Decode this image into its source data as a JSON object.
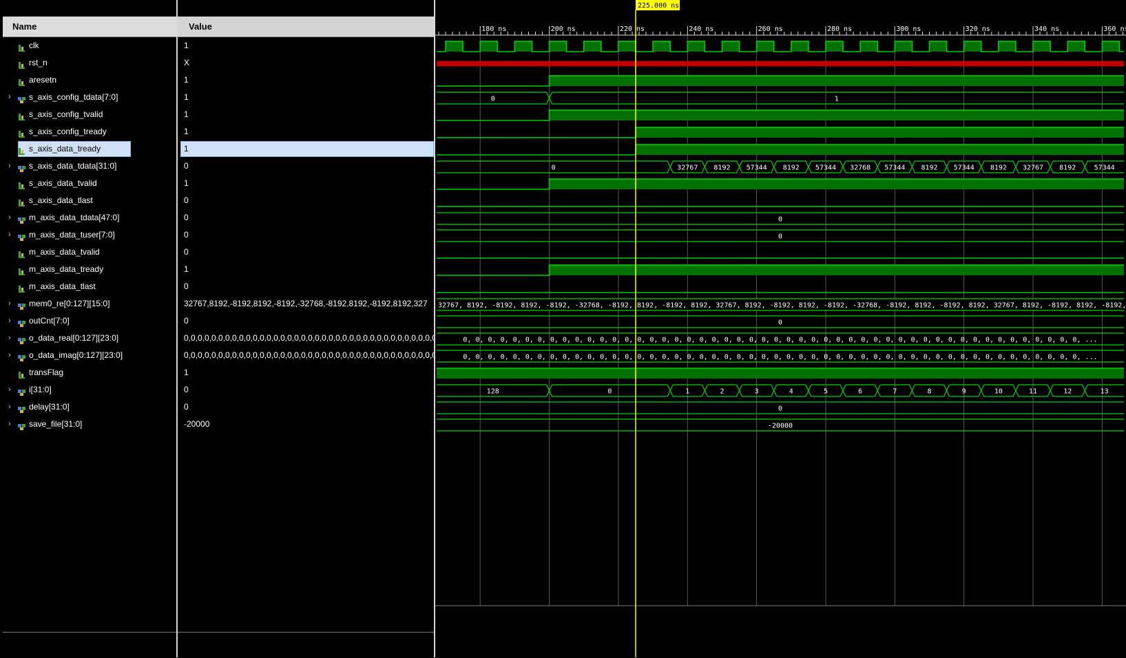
{
  "headers": {
    "name": "Name",
    "value": "Value"
  },
  "cursor_label": "225.000 ns",
  "colors": {
    "wave_green": "#00d400",
    "wave_fill": "#007000",
    "undefined_red": "#c00000",
    "cursor_yellow": "#ffff00",
    "selection": "#cfe0f7",
    "header_bg": "#dcdcdc",
    "grid": "#5a5a5a"
  },
  "time_axis": {
    "unit": "ns",
    "ticks": [
      {
        "t": 180,
        "label": "180 ns"
      },
      {
        "t": 200,
        "label": "200 ns"
      },
      {
        "t": 220,
        "label": "220 ns"
      },
      {
        "t": 240,
        "label": "240 ns"
      },
      {
        "t": 260,
        "label": "260 ns"
      },
      {
        "t": 280,
        "label": "280 ns"
      },
      {
        "t": 300,
        "label": "300 ns"
      },
      {
        "t": 320,
        "label": "320 ns"
      },
      {
        "t": 340,
        "label": "340 ns"
      },
      {
        "t": 360,
        "label": "360 ns"
      }
    ],
    "cursor_t": 225,
    "view_start": 167.4,
    "view_end": 366.3
  },
  "signals": [
    {
      "name": "clk",
      "value": "1",
      "kind": "bit",
      "icon": "bit-signal-icon",
      "expandable": false
    },
    {
      "name": "rst_n",
      "value": "X",
      "kind": "bit",
      "icon": "bit-signal-icon",
      "expandable": false
    },
    {
      "name": "aresetn",
      "value": "1",
      "kind": "bit",
      "icon": "bit-signal-icon",
      "expandable": false
    },
    {
      "name": "s_axis_config_tdata[7:0]",
      "value": "1",
      "kind": "bus",
      "icon": "bus-signal-icon",
      "expandable": true
    },
    {
      "name": "s_axis_config_tvalid",
      "value": "1",
      "kind": "bit",
      "icon": "bit-signal-icon",
      "expandable": false
    },
    {
      "name": "s_axis_config_tready",
      "value": "1",
      "kind": "bit",
      "icon": "bit-signal-icon",
      "expandable": false
    },
    {
      "name": "s_axis_data_tready",
      "value": "1",
      "kind": "bit",
      "icon": "bit-signal-icon",
      "expandable": false,
      "selected": true
    },
    {
      "name": "s_axis_data_tdata[31:0]",
      "value": "0",
      "kind": "bus",
      "icon": "bus-signal-icon",
      "expandable": true
    },
    {
      "name": "s_axis_data_tvalid",
      "value": "1",
      "kind": "bit",
      "icon": "bit-signal-icon",
      "expandable": false
    },
    {
      "name": "s_axis_data_tlast",
      "value": "0",
      "kind": "bit",
      "icon": "bit-signal-icon",
      "expandable": false
    },
    {
      "name": "m_axis_data_tdata[47:0]",
      "value": "0",
      "kind": "bus",
      "icon": "bus-signal-icon",
      "expandable": true
    },
    {
      "name": "m_axis_data_tuser[7:0]",
      "value": "0",
      "kind": "bus",
      "icon": "bus-signal-icon",
      "expandable": true
    },
    {
      "name": "m_axis_data_tvalid",
      "value": "0",
      "kind": "bit",
      "icon": "bit-signal-icon",
      "expandable": false
    },
    {
      "name": "m_axis_data_tready",
      "value": "1",
      "kind": "bit",
      "icon": "bit-signal-icon",
      "expandable": false
    },
    {
      "name": "m_axis_data_tlast",
      "value": "0",
      "kind": "bit",
      "icon": "bit-signal-icon",
      "expandable": false
    },
    {
      "name": "mem0_re[0:127][15:0]",
      "value": "32767,8192,-8192,8192,-8192,-32768,-8192,8192,-8192,8192,327",
      "kind": "bus",
      "icon": "bus-signal-icon",
      "expandable": true
    },
    {
      "name": "outCnt[7:0]",
      "value": "0",
      "kind": "bus",
      "icon": "bus-signal-icon",
      "expandable": true
    },
    {
      "name": "o_data_real[0:127][23:0]",
      "value": "0,0,0,0,0,0,0,0,0,0,0,0,0,0,0,0,0,0,0,0,0,0,0,0,0,0,0,0,0,0,0,0,0,0,0,0,0,0,0",
      "kind": "bus",
      "icon": "bus-signal-icon",
      "expandable": true
    },
    {
      "name": "o_data_imag[0:127][23:0]",
      "value": "0,0,0,0,0,0,0,0,0,0,0,0,0,0,0,0,0,0,0,0,0,0,0,0,0,0,0,0,0,0,0,0,0,0,0,0,0,0,0",
      "kind": "bus",
      "icon": "bus-signal-icon",
      "expandable": true
    },
    {
      "name": "transFlag",
      "value": "1",
      "kind": "bit",
      "icon": "bit-signal-icon",
      "expandable": false
    },
    {
      "name": "i[31:0]",
      "value": "0",
      "kind": "bus",
      "icon": "bus-signal-icon",
      "expandable": true
    },
    {
      "name": "delay[31:0]",
      "value": "0",
      "kind": "bus",
      "icon": "bus-signal-icon",
      "expandable": true
    },
    {
      "name": "save_file[31:0]",
      "value": "-20000",
      "kind": "bus",
      "icon": "bus-signal-icon",
      "expandable": true
    }
  ],
  "waves": [
    {
      "type": "clock",
      "period": 10,
      "high_first_at": 170
    },
    {
      "type": "undefined"
    },
    {
      "type": "bit",
      "init": 0,
      "changes": [
        [
          200,
          1
        ]
      ]
    },
    {
      "type": "bus",
      "segments": [
        [
          167.4,
          200,
          "0"
        ],
        [
          200,
          366.3,
          "1"
        ]
      ]
    },
    {
      "type": "bit",
      "init": 0,
      "changes": [
        [
          200,
          1
        ]
      ]
    },
    {
      "type": "bit",
      "init": 0,
      "changes": [
        [
          225,
          1
        ]
      ]
    },
    {
      "type": "bit",
      "init": 0,
      "changes": [
        [
          225,
          1
        ]
      ]
    },
    {
      "type": "bus",
      "segments": [
        [
          167.4,
          235,
          "0"
        ],
        [
          235,
          245,
          "32767"
        ],
        [
          245,
          255,
          "8192"
        ],
        [
          255,
          265,
          "57344"
        ],
        [
          265,
          275,
          "8192"
        ],
        [
          275,
          285,
          "57344"
        ],
        [
          285,
          295,
          "32768"
        ],
        [
          295,
          305,
          "57344"
        ],
        [
          305,
          315,
          "8192"
        ],
        [
          315,
          325,
          "57344"
        ],
        [
          325,
          335,
          "8192"
        ],
        [
          335,
          345,
          "32767"
        ],
        [
          345,
          355,
          "8192"
        ],
        [
          355,
          366.3,
          "57344"
        ]
      ]
    },
    {
      "type": "bit",
      "init": 0,
      "changes": [
        [
          200,
          1
        ]
      ]
    },
    {
      "type": "bit",
      "init": 0,
      "changes": []
    },
    {
      "type": "bus",
      "segments": [
        [
          167.4,
          366.3,
          "0"
        ]
      ]
    },
    {
      "type": "bus",
      "segments": [
        [
          167.4,
          366.3,
          "0"
        ]
      ]
    },
    {
      "type": "bit",
      "init": 0,
      "changes": []
    },
    {
      "type": "bit",
      "init": 0,
      "changes": [
        [
          200,
          1
        ]
      ]
    },
    {
      "type": "bit",
      "init": 0,
      "changes": []
    },
    {
      "type": "bus_text",
      "text": "32767, 8192, -8192, 8192, -8192, -32768, -8192, 8192, -8192, 8192, 32767, 8192, -8192, 8192, -8192, -32768, -8192, 8192, -8192, 8192, 32767, 8192, -8192, 8192, -8192, -32768, -8192, 8192, -81"
    },
    {
      "type": "bus",
      "segments": [
        [
          167.4,
          366.3,
          "0"
        ]
      ]
    },
    {
      "type": "bus",
      "segments": [
        [
          167.4,
          366.3,
          "0, 0, 0, 0, 0, 0, 0, 0, 0, 0, 0, 0, 0, 0, 0, 0, 0, 0, 0, 0, 0, 0, 0, 0, 0, 0, 0, 0, 0, 0, 0, 0, 0, 0, 0, 0, 0, 0, 0, 0, 0, 0, 0, 0, 0, 0, 0, 0, 0, 0, ..."
        ]
      ]
    },
    {
      "type": "bus",
      "segments": [
        [
          167.4,
          366.3,
          "0, 0, 0, 0, 0, 0, 0, 0, 0, 0, 0, 0, 0, 0, 0, 0, 0, 0, 0, 0, 0, 0, 0, 0, 0, 0, 0, 0, 0, 0, 0, 0, 0, 0, 0, 0, 0, 0, 0, 0, 0, 0, 0, 0, 0, 0, 0, 0, 0, 0, ..."
        ]
      ]
    },
    {
      "type": "bit",
      "init": 1,
      "changes": []
    },
    {
      "type": "bus",
      "segments": [
        [
          167.4,
          200,
          "128"
        ],
        [
          200,
          235,
          "0"
        ],
        [
          235,
          245,
          "1"
        ],
        [
          245,
          255,
          "2"
        ],
        [
          255,
          265,
          "3"
        ],
        [
          265,
          275,
          "4"
        ],
        [
          275,
          285,
          "5"
        ],
        [
          285,
          295,
          "6"
        ],
        [
          295,
          305,
          "7"
        ],
        [
          305,
          315,
          "8"
        ],
        [
          315,
          325,
          "9"
        ],
        [
          325,
          335,
          "10"
        ],
        [
          335,
          345,
          "11"
        ],
        [
          345,
          355,
          "12"
        ],
        [
          355,
          366.3,
          "13"
        ]
      ]
    },
    {
      "type": "bus",
      "segments": [
        [
          167.4,
          366.3,
          "0"
        ]
      ]
    },
    {
      "type": "bus",
      "segments": [
        [
          167.4,
          366.3,
          "-20000"
        ]
      ]
    }
  ]
}
